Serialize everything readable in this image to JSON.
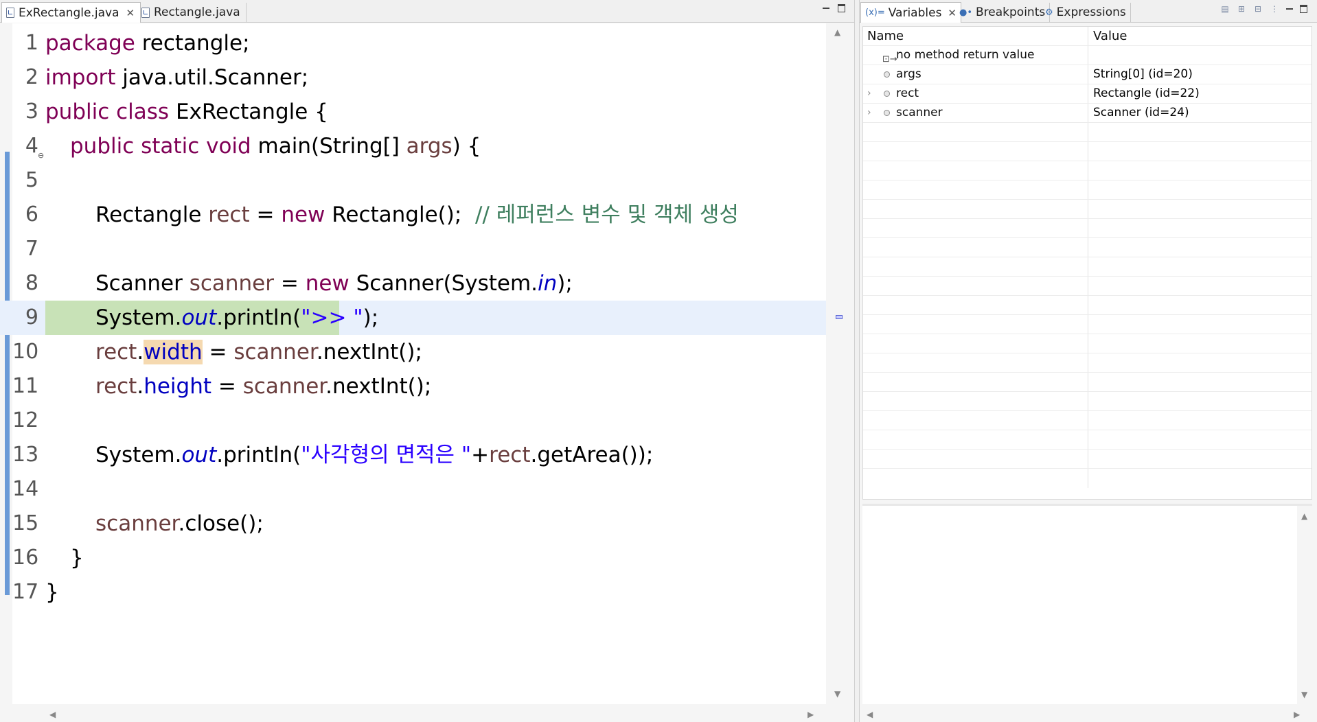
{
  "editor": {
    "tabs": [
      {
        "label": "ExRectangle.java",
        "active": true
      },
      {
        "label": "Rectangle.java",
        "active": false
      }
    ],
    "current_line": 9,
    "lines": [
      {
        "n": "1"
      },
      {
        "n": "2"
      },
      {
        "n": "3"
      },
      {
        "n": "4"
      },
      {
        "n": "5"
      },
      {
        "n": "6"
      },
      {
        "n": "7"
      },
      {
        "n": "8"
      },
      {
        "n": "9"
      },
      {
        "n": "10"
      },
      {
        "n": "11"
      },
      {
        "n": "12"
      },
      {
        "n": "13"
      },
      {
        "n": "14"
      },
      {
        "n": "15"
      },
      {
        "n": "16"
      },
      {
        "n": "17"
      }
    ],
    "code": {
      "l1_kw": "package",
      "l1_rest": " rectangle;",
      "l2_kw": "import",
      "l2_rest": " java.util.Scanner;",
      "l3_kw": "public class",
      "l3_rest": " ExRectangle {",
      "l4_kw": "public static void",
      "l4_a": " main(String[] ",
      "l4_var": "args",
      "l4_b": ") {",
      "l6_a": "Rectangle ",
      "l6_var": "rect",
      "l6_b": " = ",
      "l6_kw": "new",
      "l6_c": " Rectangle();  ",
      "l6_cmt": "// 레퍼런스 변수 및 객체 생성",
      "l8_a": "Scanner ",
      "l8_var": "scanner",
      "l8_b": " = ",
      "l8_kw": "new",
      "l8_c": " Scanner(System.",
      "l8_static": "in",
      "l8_d": ");",
      "l9_a": "System.",
      "l9_static": "out",
      "l9_b": ".println(",
      "l9_str": "\">> \"",
      "l9_c": ");",
      "l10_var": "rect",
      "l10_a": ".",
      "l10_fld": "width",
      "l10_b": " = ",
      "l10_var2": "scanner",
      "l10_c": ".nextInt();",
      "l11_var": "rect",
      "l11_a": ".",
      "l11_fld": "height",
      "l11_b": " = ",
      "l11_var2": "scanner",
      "l11_c": ".nextInt();",
      "l13_a": "System.",
      "l13_static": "out",
      "l13_b": ".println(",
      "l13_str": "\"사각형의 면적은 \"",
      "l13_c": "+",
      "l13_var": "rect",
      "l13_d": ".getArea());",
      "l15_var": "scanner",
      "l15_a": ".close();",
      "l16": "}",
      "l17": "}"
    }
  },
  "debug": {
    "tabs": [
      {
        "label": "Variables",
        "icon": "variables-icon",
        "active": true
      },
      {
        "label": "Breakpoints",
        "icon": "breakpoints-icon",
        "active": false
      },
      {
        "label": "Expressions",
        "icon": "expressions-icon",
        "active": false
      }
    ],
    "columns": {
      "name": "Name",
      "value": "Value"
    },
    "rows": [
      {
        "name": "no method return value",
        "value": "",
        "expandable": false
      },
      {
        "name": "args",
        "value": "String[0]  (id=20)",
        "expandable": false
      },
      {
        "name": "rect",
        "value": "Rectangle  (id=22)",
        "expandable": true
      },
      {
        "name": "scanner",
        "value": "Scanner  (id=24)",
        "expandable": true
      }
    ]
  },
  "colors": {
    "keyword": "#7f0055",
    "local_variable": "#6a3e3e",
    "field": "#0000c0",
    "string": "#2a00ff",
    "comment": "#3f7f5f",
    "current_line_bg": "#e8f0fc",
    "current_instruction_bg": "#c8e2b7",
    "occurrence_bg": "#f5d9b0"
  }
}
